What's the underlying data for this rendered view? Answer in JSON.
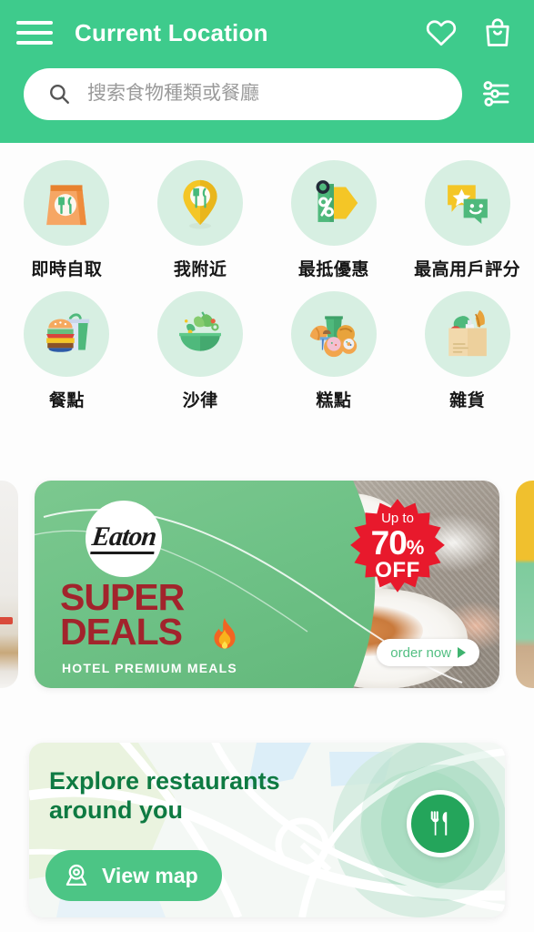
{
  "header": {
    "title": "Current Location",
    "menu_icon": "hamburger-menu-icon",
    "favorites_icon": "heart-icon",
    "cart_icon": "shopping-bag-icon"
  },
  "search": {
    "placeholder": "搜索食物種類或餐廳",
    "value": "",
    "search_icon": "magnifier-icon",
    "filter_icon": "filter-sliders-icon"
  },
  "categories": [
    {
      "label": "即時自取",
      "icon": "takeaway-bag-icon"
    },
    {
      "label": "我附近",
      "icon": "location-pin-cutlery-icon"
    },
    {
      "label": "最抵優惠",
      "icon": "discount-tag-percent-icon"
    },
    {
      "label": "最高用戶評分",
      "icon": "star-chat-bubbles-icon"
    },
    {
      "label": "餐點",
      "icon": "burger-drink-icon"
    },
    {
      "label": "沙律",
      "icon": "salad-bowl-icon"
    },
    {
      "label": "糕點",
      "icon": "pastry-coffee-icon"
    },
    {
      "label": "雜貨",
      "icon": "grocery-bag-icon"
    }
  ],
  "banner": {
    "brand": "Eaton",
    "headline_line1": "SUPER",
    "headline_line2": "DEALS",
    "subtitle": "HOTEL PREMIUM MEALS",
    "flame_icon": "flame-icon",
    "badge": {
      "prefix": "Up to",
      "number": "70",
      "percent": "%",
      "suffix": "OFF"
    },
    "cta_label": "order now",
    "cta_icon": "play-triangle-icon"
  },
  "map_card": {
    "title": "Explore restaurants around you",
    "button_label": "View map",
    "button_icon": "map-pin-icon",
    "fab_icon": "fork-knife-icon"
  },
  "colors": {
    "brand_green": "#3ECB8C",
    "category_circle": "#D7EFE2",
    "deal_red": "#A2242C",
    "badge_red": "#E8192C",
    "map_title_green": "#0E7A42",
    "button_green": "#4CC585",
    "fab_green": "#24A55B"
  }
}
